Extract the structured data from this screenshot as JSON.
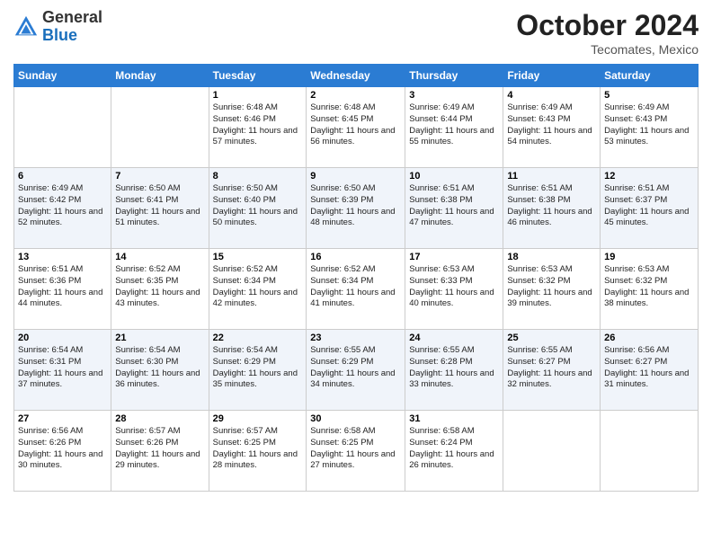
{
  "header": {
    "logo": {
      "general": "General",
      "blue": "Blue"
    },
    "title": "October 2024",
    "location": "Tecomates, Mexico"
  },
  "weekdays": [
    "Sunday",
    "Monday",
    "Tuesday",
    "Wednesday",
    "Thursday",
    "Friday",
    "Saturday"
  ],
  "weeks": [
    [
      {
        "date": "",
        "sunrise": "",
        "sunset": "",
        "daylight": ""
      },
      {
        "date": "",
        "sunrise": "",
        "sunset": "",
        "daylight": ""
      },
      {
        "date": "1",
        "sunrise": "Sunrise: 6:48 AM",
        "sunset": "Sunset: 6:46 PM",
        "daylight": "Daylight: 11 hours and 57 minutes."
      },
      {
        "date": "2",
        "sunrise": "Sunrise: 6:48 AM",
        "sunset": "Sunset: 6:45 PM",
        "daylight": "Daylight: 11 hours and 56 minutes."
      },
      {
        "date": "3",
        "sunrise": "Sunrise: 6:49 AM",
        "sunset": "Sunset: 6:44 PM",
        "daylight": "Daylight: 11 hours and 55 minutes."
      },
      {
        "date": "4",
        "sunrise": "Sunrise: 6:49 AM",
        "sunset": "Sunset: 6:43 PM",
        "daylight": "Daylight: 11 hours and 54 minutes."
      },
      {
        "date": "5",
        "sunrise": "Sunrise: 6:49 AM",
        "sunset": "Sunset: 6:43 PM",
        "daylight": "Daylight: 11 hours and 53 minutes."
      }
    ],
    [
      {
        "date": "6",
        "sunrise": "Sunrise: 6:49 AM",
        "sunset": "Sunset: 6:42 PM",
        "daylight": "Daylight: 11 hours and 52 minutes."
      },
      {
        "date": "7",
        "sunrise": "Sunrise: 6:50 AM",
        "sunset": "Sunset: 6:41 PM",
        "daylight": "Daylight: 11 hours and 51 minutes."
      },
      {
        "date": "8",
        "sunrise": "Sunrise: 6:50 AM",
        "sunset": "Sunset: 6:40 PM",
        "daylight": "Daylight: 11 hours and 50 minutes."
      },
      {
        "date": "9",
        "sunrise": "Sunrise: 6:50 AM",
        "sunset": "Sunset: 6:39 PM",
        "daylight": "Daylight: 11 hours and 48 minutes."
      },
      {
        "date": "10",
        "sunrise": "Sunrise: 6:51 AM",
        "sunset": "Sunset: 6:38 PM",
        "daylight": "Daylight: 11 hours and 47 minutes."
      },
      {
        "date": "11",
        "sunrise": "Sunrise: 6:51 AM",
        "sunset": "Sunset: 6:38 PM",
        "daylight": "Daylight: 11 hours and 46 minutes."
      },
      {
        "date": "12",
        "sunrise": "Sunrise: 6:51 AM",
        "sunset": "Sunset: 6:37 PM",
        "daylight": "Daylight: 11 hours and 45 minutes."
      }
    ],
    [
      {
        "date": "13",
        "sunrise": "Sunrise: 6:51 AM",
        "sunset": "Sunset: 6:36 PM",
        "daylight": "Daylight: 11 hours and 44 minutes."
      },
      {
        "date": "14",
        "sunrise": "Sunrise: 6:52 AM",
        "sunset": "Sunset: 6:35 PM",
        "daylight": "Daylight: 11 hours and 43 minutes."
      },
      {
        "date": "15",
        "sunrise": "Sunrise: 6:52 AM",
        "sunset": "Sunset: 6:34 PM",
        "daylight": "Daylight: 11 hours and 42 minutes."
      },
      {
        "date": "16",
        "sunrise": "Sunrise: 6:52 AM",
        "sunset": "Sunset: 6:34 PM",
        "daylight": "Daylight: 11 hours and 41 minutes."
      },
      {
        "date": "17",
        "sunrise": "Sunrise: 6:53 AM",
        "sunset": "Sunset: 6:33 PM",
        "daylight": "Daylight: 11 hours and 40 minutes."
      },
      {
        "date": "18",
        "sunrise": "Sunrise: 6:53 AM",
        "sunset": "Sunset: 6:32 PM",
        "daylight": "Daylight: 11 hours and 39 minutes."
      },
      {
        "date": "19",
        "sunrise": "Sunrise: 6:53 AM",
        "sunset": "Sunset: 6:32 PM",
        "daylight": "Daylight: 11 hours and 38 minutes."
      }
    ],
    [
      {
        "date": "20",
        "sunrise": "Sunrise: 6:54 AM",
        "sunset": "Sunset: 6:31 PM",
        "daylight": "Daylight: 11 hours and 37 minutes."
      },
      {
        "date": "21",
        "sunrise": "Sunrise: 6:54 AM",
        "sunset": "Sunset: 6:30 PM",
        "daylight": "Daylight: 11 hours and 36 minutes."
      },
      {
        "date": "22",
        "sunrise": "Sunrise: 6:54 AM",
        "sunset": "Sunset: 6:29 PM",
        "daylight": "Daylight: 11 hours and 35 minutes."
      },
      {
        "date": "23",
        "sunrise": "Sunrise: 6:55 AM",
        "sunset": "Sunset: 6:29 PM",
        "daylight": "Daylight: 11 hours and 34 minutes."
      },
      {
        "date": "24",
        "sunrise": "Sunrise: 6:55 AM",
        "sunset": "Sunset: 6:28 PM",
        "daylight": "Daylight: 11 hours and 33 minutes."
      },
      {
        "date": "25",
        "sunrise": "Sunrise: 6:55 AM",
        "sunset": "Sunset: 6:27 PM",
        "daylight": "Daylight: 11 hours and 32 minutes."
      },
      {
        "date": "26",
        "sunrise": "Sunrise: 6:56 AM",
        "sunset": "Sunset: 6:27 PM",
        "daylight": "Daylight: 11 hours and 31 minutes."
      }
    ],
    [
      {
        "date": "27",
        "sunrise": "Sunrise: 6:56 AM",
        "sunset": "Sunset: 6:26 PM",
        "daylight": "Daylight: 11 hours and 30 minutes."
      },
      {
        "date": "28",
        "sunrise": "Sunrise: 6:57 AM",
        "sunset": "Sunset: 6:26 PM",
        "daylight": "Daylight: 11 hours and 29 minutes."
      },
      {
        "date": "29",
        "sunrise": "Sunrise: 6:57 AM",
        "sunset": "Sunset: 6:25 PM",
        "daylight": "Daylight: 11 hours and 28 minutes."
      },
      {
        "date": "30",
        "sunrise": "Sunrise: 6:58 AM",
        "sunset": "Sunset: 6:25 PM",
        "daylight": "Daylight: 11 hours and 27 minutes."
      },
      {
        "date": "31",
        "sunrise": "Sunrise: 6:58 AM",
        "sunset": "Sunset: 6:24 PM",
        "daylight": "Daylight: 11 hours and 26 minutes."
      },
      {
        "date": "",
        "sunrise": "",
        "sunset": "",
        "daylight": ""
      },
      {
        "date": "",
        "sunrise": "",
        "sunset": "",
        "daylight": ""
      }
    ]
  ]
}
